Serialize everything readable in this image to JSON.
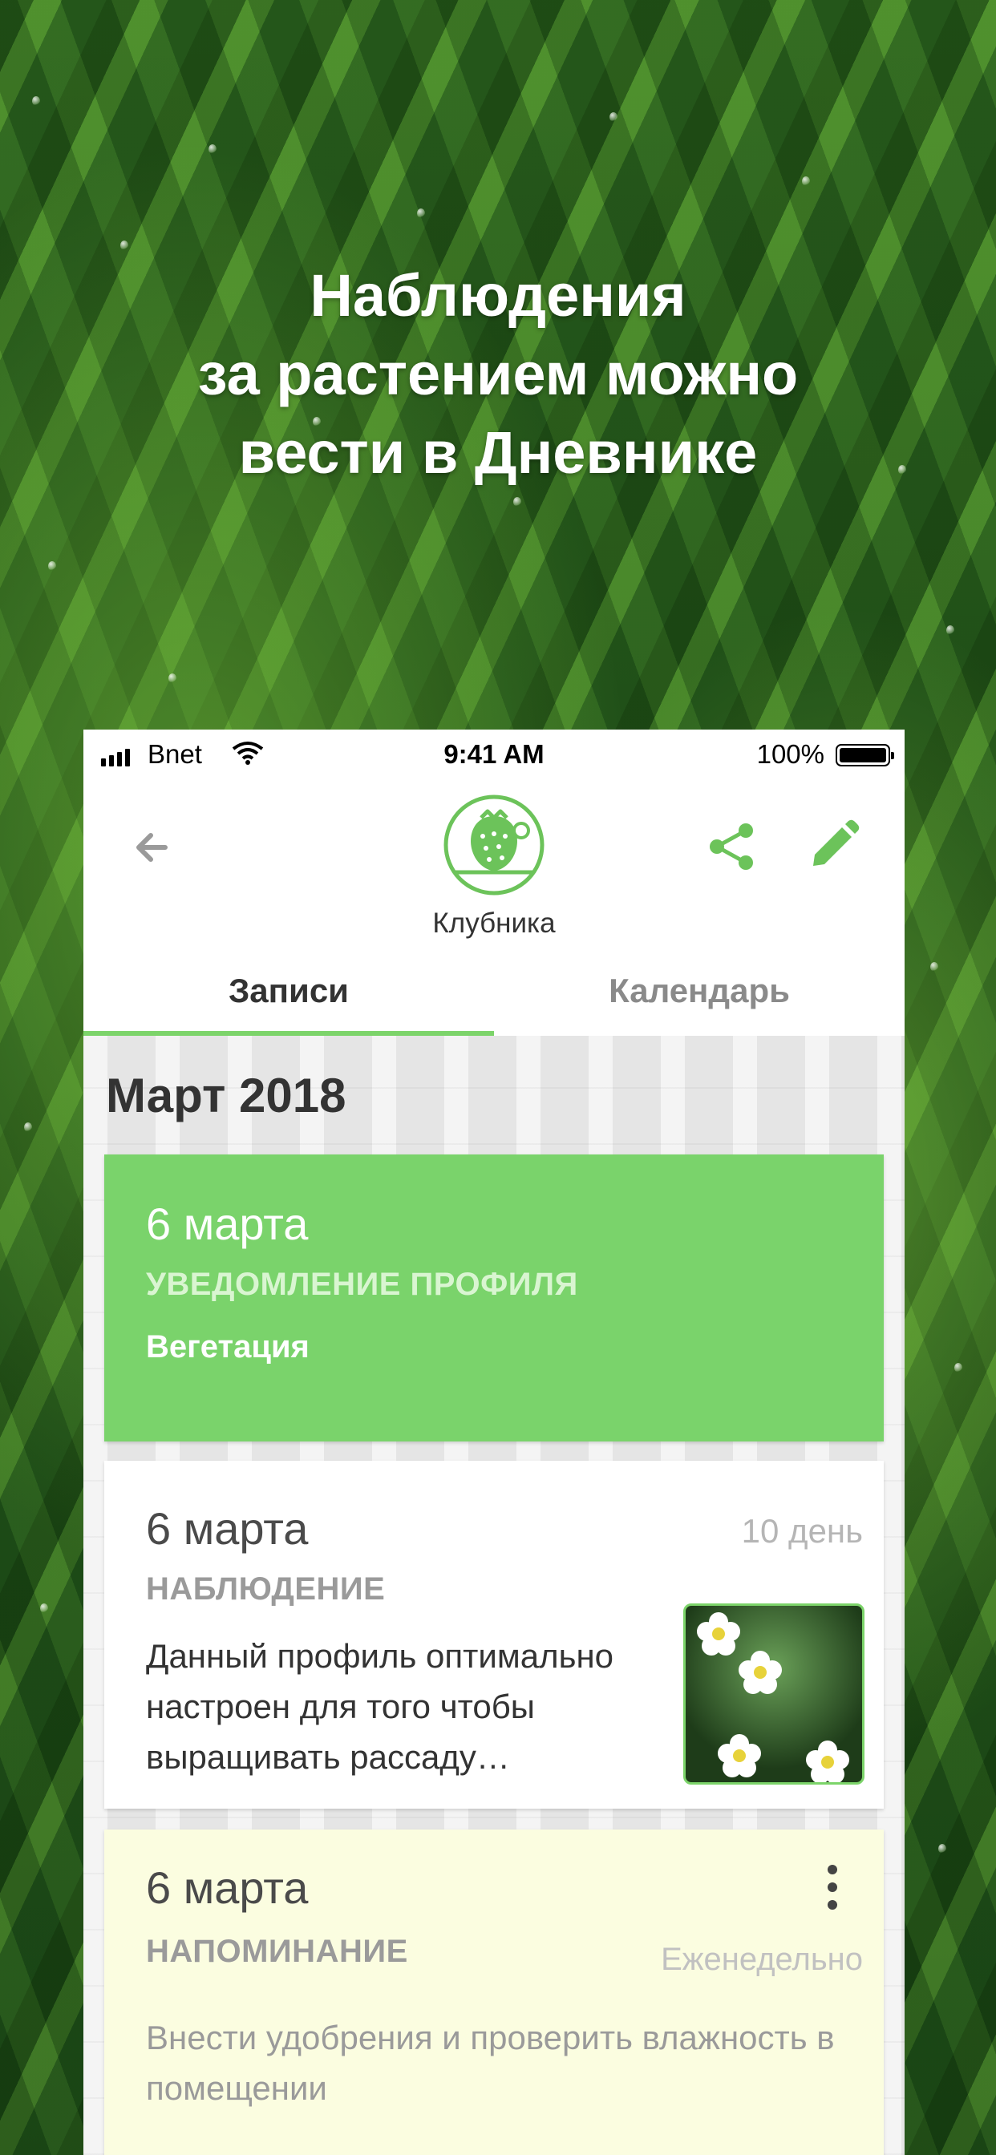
{
  "headline": {
    "lines": [
      "Наблюдения",
      "за растением можно",
      "вести в Дневнике"
    ]
  },
  "status_bar": {
    "carrier": "Bnet",
    "time": "9:41 AM",
    "battery": "100%"
  },
  "app_bar": {
    "back_icon": "arrow-left-icon",
    "plant_icon": "strawberry-icon",
    "plant_name": "Клубника",
    "share_icon": "share-icon",
    "edit_icon": "pencil-icon"
  },
  "tabs": [
    {
      "label": "Записи",
      "active": true
    },
    {
      "label": "Календарь",
      "active": false
    }
  ],
  "feed": {
    "month": "Март 2018",
    "entries": [
      {
        "date": "6 марта",
        "type": "УВЕДОМЛЕНИЕ ПРОФИЛЯ",
        "subtitle": "Вегетация",
        "color": "#7ad36b"
      },
      {
        "date": "6 марта",
        "day": "10 день",
        "type": "НАБЛЮДЕНИЕ",
        "text": "Данный профиль оптимально настроен для того чтобы выращивать рассаду…",
        "photo": "strawberry-flowers-photo",
        "color": "#ffffff"
      },
      {
        "date": "6 марта",
        "type": "НАПОМИНАНИЕ",
        "frequency": "Еженедельно",
        "text": "Внести удобрения и проверить влажность в помещении",
        "menu_icon": "more-vertical-icon",
        "color": "#fbfde0"
      }
    ]
  },
  "colors": {
    "accent": "#7cd46a",
    "text_dark": "#333333",
    "text_muted": "#9a9a9a"
  }
}
